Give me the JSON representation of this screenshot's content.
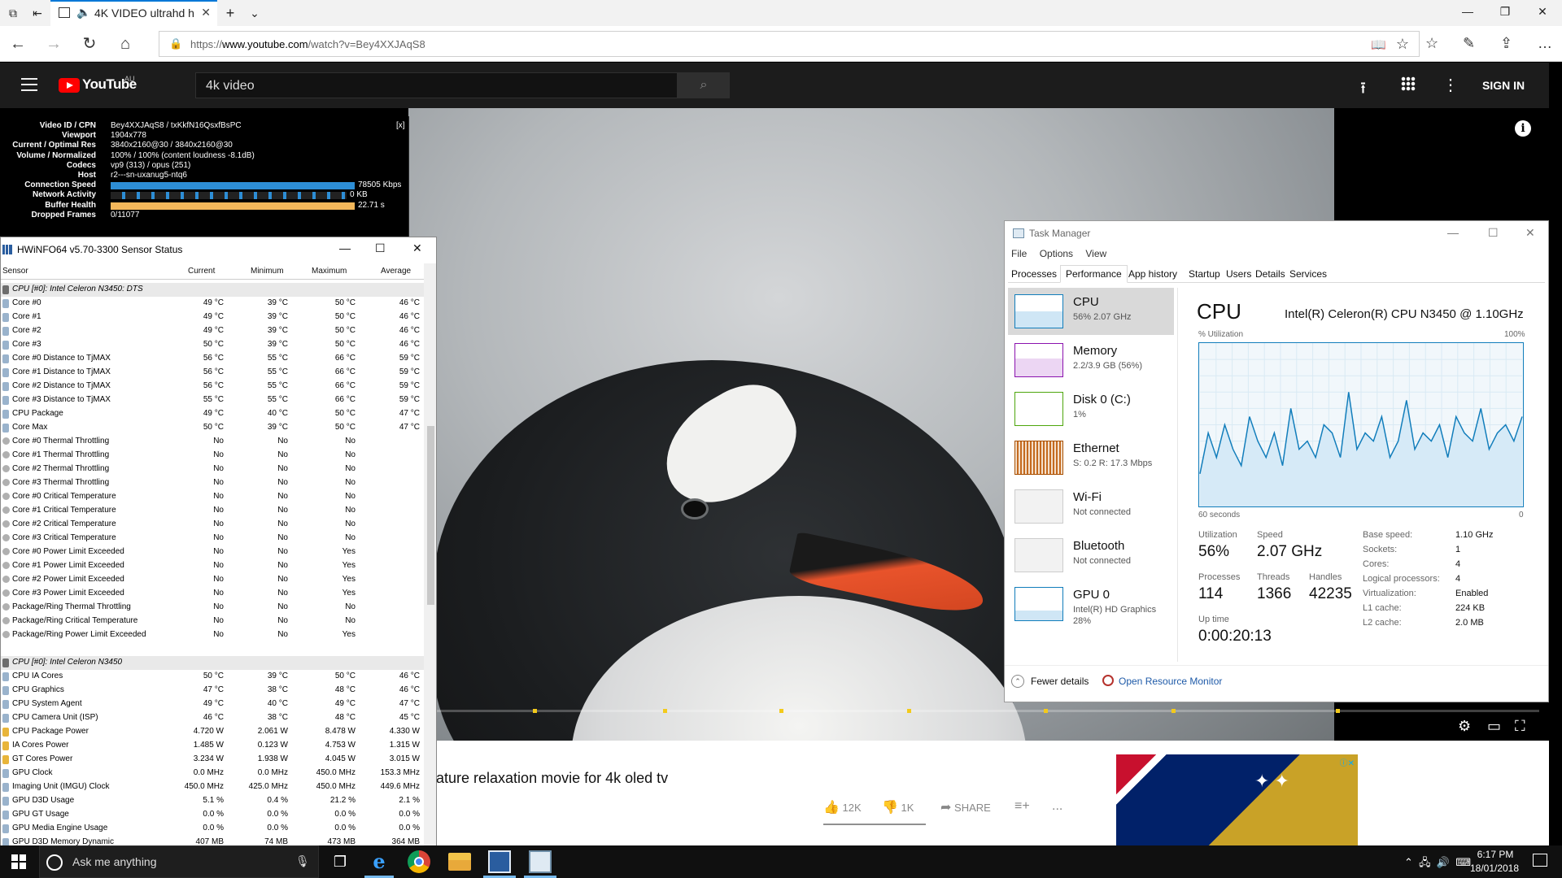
{
  "browser": {
    "tab_title": "4K VIDEO ultrahd h",
    "url_prefix": "https://",
    "url_host": "www.youtube.com",
    "url_path": "/watch?v=Bey4XXJAqS8"
  },
  "youtube": {
    "brand": "YouTube",
    "region": "AU",
    "search_value": "4k video",
    "sign_in": "SIGN IN",
    "video_title": "ature relaxation movie for 4k oled tv",
    "likes": "12K",
    "dislikes": "1K",
    "share": "SHARE",
    "more": "...",
    "info": "i"
  },
  "stats_for_nerds": {
    "close": "[x]",
    "rows": [
      {
        "label": "Video ID / CPN",
        "value": "Bey4XXJAqS8 / txKkfN16QsxfBsPC"
      },
      {
        "label": "Viewport",
        "value": "1904x778"
      },
      {
        "label": "Current / Optimal Res",
        "value": "3840x2160@30 / 3840x2160@30"
      },
      {
        "label": "Volume / Normalized",
        "value": "100% / 100% (content loudness -8.1dB)"
      },
      {
        "label": "Codecs",
        "value": "vp9 (313) / opus (251)"
      },
      {
        "label": "Host",
        "value": "r2---sn-uxanug5-ntq6"
      },
      {
        "label": "Connection Speed",
        "value": "78505 Kbps"
      },
      {
        "label": "Network Activity",
        "value": "0 KB"
      },
      {
        "label": "Buffer Health",
        "value": "22.71 s"
      },
      {
        "label": "Dropped Frames",
        "value": "0/11077"
      }
    ]
  },
  "hwinfo": {
    "title": "HWiNFO64 v5.70-3300 Sensor Status",
    "columns": [
      "Sensor",
      "Current",
      "Minimum",
      "Maximum",
      "Average"
    ],
    "rows": [
      {
        "group": true,
        "name": "CPU [#0]: Intel Celeron N3450: DTS"
      },
      {
        "name": "Core #0",
        "cur": "49 °C",
        "min": "39 °C",
        "max": "50 °C",
        "avg": "46 °C",
        "icon": "temp"
      },
      {
        "name": "Core #1",
        "cur": "49 °C",
        "min": "39 °C",
        "max": "50 °C",
        "avg": "46 °C",
        "icon": "temp"
      },
      {
        "name": "Core #2",
        "cur": "49 °C",
        "min": "39 °C",
        "max": "50 °C",
        "avg": "46 °C",
        "icon": "temp"
      },
      {
        "name": "Core #3",
        "cur": "50 °C",
        "min": "39 °C",
        "max": "50 °C",
        "avg": "46 °C",
        "icon": "temp"
      },
      {
        "name": "Core #0 Distance to TjMAX",
        "cur": "56 °C",
        "min": "55 °C",
        "max": "66 °C",
        "avg": "59 °C",
        "icon": "temp"
      },
      {
        "name": "Core #1 Distance to TjMAX",
        "cur": "56 °C",
        "min": "55 °C",
        "max": "66 °C",
        "avg": "59 °C",
        "icon": "temp"
      },
      {
        "name": "Core #2 Distance to TjMAX",
        "cur": "56 °C",
        "min": "55 °C",
        "max": "66 °C",
        "avg": "59 °C",
        "icon": "temp"
      },
      {
        "name": "Core #3 Distance to TjMAX",
        "cur": "55 °C",
        "min": "55 °C",
        "max": "66 °C",
        "avg": "59 °C",
        "icon": "temp"
      },
      {
        "name": "CPU Package",
        "cur": "49 °C",
        "min": "40 °C",
        "max": "50 °C",
        "avg": "47 °C",
        "icon": "temp"
      },
      {
        "name": "Core Max",
        "cur": "50 °C",
        "min": "39 °C",
        "max": "50 °C",
        "avg": "47 °C",
        "icon": "temp"
      },
      {
        "name": "Core #0 Thermal Throttling",
        "cur": "No",
        "min": "No",
        "max": "No",
        "avg": "",
        "icon": "bool"
      },
      {
        "name": "Core #1 Thermal Throttling",
        "cur": "No",
        "min": "No",
        "max": "No",
        "avg": "",
        "icon": "bool"
      },
      {
        "name": "Core #2 Thermal Throttling",
        "cur": "No",
        "min": "No",
        "max": "No",
        "avg": "",
        "icon": "bool"
      },
      {
        "name": "Core #3 Thermal Throttling",
        "cur": "No",
        "min": "No",
        "max": "No",
        "avg": "",
        "icon": "bool"
      },
      {
        "name": "Core #0 Critical Temperature",
        "cur": "No",
        "min": "No",
        "max": "No",
        "avg": "",
        "icon": "bool"
      },
      {
        "name": "Core #1 Critical Temperature",
        "cur": "No",
        "min": "No",
        "max": "No",
        "avg": "",
        "icon": "bool"
      },
      {
        "name": "Core #2 Critical Temperature",
        "cur": "No",
        "min": "No",
        "max": "No",
        "avg": "",
        "icon": "bool"
      },
      {
        "name": "Core #3 Critical Temperature",
        "cur": "No",
        "min": "No",
        "max": "No",
        "avg": "",
        "icon": "bool"
      },
      {
        "name": "Core #0 Power Limit Exceeded",
        "cur": "No",
        "min": "No",
        "max": "Yes",
        "avg": "",
        "icon": "bool"
      },
      {
        "name": "Core #1 Power Limit Exceeded",
        "cur": "No",
        "min": "No",
        "max": "Yes",
        "avg": "",
        "icon": "bool"
      },
      {
        "name": "Core #2 Power Limit Exceeded",
        "cur": "No",
        "min": "No",
        "max": "Yes",
        "avg": "",
        "icon": "bool"
      },
      {
        "name": "Core #3 Power Limit Exceeded",
        "cur": "No",
        "min": "No",
        "max": "Yes",
        "avg": "",
        "icon": "bool"
      },
      {
        "name": "Package/Ring Thermal Throttling",
        "cur": "No",
        "min": "No",
        "max": "No",
        "avg": "",
        "icon": "bool"
      },
      {
        "name": "Package/Ring Critical Temperature",
        "cur": "No",
        "min": "No",
        "max": "No",
        "avg": "",
        "icon": "bool"
      },
      {
        "name": "Package/Ring Power Limit Exceeded",
        "cur": "No",
        "min": "No",
        "max": "Yes",
        "avg": "",
        "icon": "bool"
      },
      {
        "spacer": true
      },
      {
        "group": true,
        "name": "CPU [#0]: Intel Celeron N3450"
      },
      {
        "name": "CPU IA Cores",
        "cur": "50 °C",
        "min": "39 °C",
        "max": "50 °C",
        "avg": "46 °C",
        "icon": "temp"
      },
      {
        "name": "CPU Graphics",
        "cur": "47 °C",
        "min": "38 °C",
        "max": "48 °C",
        "avg": "46 °C",
        "icon": "temp"
      },
      {
        "name": "CPU System Agent",
        "cur": "49 °C",
        "min": "40 °C",
        "max": "49 °C",
        "avg": "47 °C",
        "icon": "temp"
      },
      {
        "name": "CPU Camera Unit (ISP)",
        "cur": "46 °C",
        "min": "38 °C",
        "max": "48 °C",
        "avg": "45 °C",
        "icon": "temp"
      },
      {
        "name": "CPU Package Power",
        "cur": "4.720 W",
        "min": "2.061 W",
        "max": "8.478 W",
        "avg": "4.330 W",
        "icon": "power"
      },
      {
        "name": "IA Cores Power",
        "cur": "1.485 W",
        "min": "0.123 W",
        "max": "4.753 W",
        "avg": "1.315 W",
        "icon": "power"
      },
      {
        "name": "GT Cores Power",
        "cur": "3.234 W",
        "min": "1.938 W",
        "max": "4.045 W",
        "avg": "3.015 W",
        "icon": "power"
      },
      {
        "name": "GPU Clock",
        "cur": "0.0 MHz",
        "min": "0.0 MHz",
        "max": "450.0 MHz",
        "avg": "153.3 MHz",
        "icon": "clock"
      },
      {
        "name": "Imaging Unit (IMGU) Clock",
        "cur": "450.0 MHz",
        "min": "425.0 MHz",
        "max": "450.0 MHz",
        "avg": "449.6 MHz",
        "icon": "clock"
      },
      {
        "name": "GPU D3D Usage",
        "cur": "5.1 %",
        "min": "0.4 %",
        "max": "21.2 %",
        "avg": "2.1 %",
        "icon": "clock"
      },
      {
        "name": "GPU GT Usage",
        "cur": "0.0 %",
        "min": "0.0 %",
        "max": "0.0 %",
        "avg": "0.0 %",
        "icon": "clock"
      },
      {
        "name": "GPU Media Engine Usage",
        "cur": "0.0 %",
        "min": "0.0 %",
        "max": "0.0 %",
        "avg": "0.0 %",
        "icon": "clock"
      },
      {
        "name": "GPU D3D Memory Dynamic",
        "cur": "407 MB",
        "min": "74 MB",
        "max": "473 MB",
        "avg": "364 MB",
        "icon": "clock"
      }
    ]
  },
  "taskmanager": {
    "title": "Task Manager",
    "menu": [
      "File",
      "Options",
      "View"
    ],
    "tabs": [
      "Processes",
      "Performance",
      "App history",
      "Startup",
      "Users",
      "Details",
      "Services"
    ],
    "active_tab": "Performance",
    "sidebar": [
      {
        "name": "CPU",
        "sub1": "56% 2.07 GHz",
        "sub2": "",
        "color": "#117dbb"
      },
      {
        "name": "Memory",
        "sub1": "2.2/3.9 GB (56%)",
        "sub2": "",
        "color": "#8b12ae"
      },
      {
        "name": "Disk 0 (C:)",
        "sub1": "1%",
        "sub2": "",
        "color": "#4da60c"
      },
      {
        "name": "Ethernet",
        "sub1": "S: 0.2  R: 17.3 Mbps",
        "sub2": "",
        "color": "#a74f01"
      },
      {
        "name": "Wi-Fi",
        "sub1": "Not connected",
        "sub2": "",
        "color": "#cccccc"
      },
      {
        "name": "Bluetooth",
        "sub1": "Not connected",
        "sub2": "",
        "color": "#cccccc"
      },
      {
        "name": "GPU 0",
        "sub1": "Intel(R) HD Graphics",
        "sub2": "28%",
        "color": "#117dbb"
      }
    ],
    "heading": "CPU",
    "model": "Intel(R) Celeron(R) CPU N3450 @ 1.10GHz",
    "util_label": "% Utilization",
    "util_max": "100%",
    "graph_left": "60 seconds",
    "graph_right": "0",
    "stats": {
      "utilization_label": "Utilization",
      "utilization": "56%",
      "speed_label": "Speed",
      "speed": "2.07 GHz",
      "processes_label": "Processes",
      "processes": "114",
      "threads_label": "Threads",
      "threads": "1366",
      "handles_label": "Handles",
      "handles": "42235",
      "uptime_label": "Up time",
      "uptime": "0:00:20:13"
    },
    "specs": [
      {
        "k": "Base speed:",
        "v": "1.10 GHz"
      },
      {
        "k": "Sockets:",
        "v": "1"
      },
      {
        "k": "Cores:",
        "v": "4"
      },
      {
        "k": "Logical processors:",
        "v": "4"
      },
      {
        "k": "Virtualization:",
        "v": "Enabled"
      },
      {
        "k": "L1 cache:",
        "v": "224 KB"
      },
      {
        "k": "L2 cache:",
        "v": "2.0 MB"
      }
    ],
    "fewer_details": "Fewer details",
    "resource_monitor": "Open Resource Monitor",
    "cpu_series": [
      20,
      45,
      30,
      50,
      35,
      25,
      55,
      40,
      30,
      45,
      25,
      60,
      35,
      40,
      30,
      50,
      45,
      30,
      70,
      35,
      45,
      40,
      55,
      30,
      40,
      65,
      35,
      45,
      40,
      50,
      30,
      55,
      45,
      40,
      60,
      35,
      45,
      50,
      40,
      55
    ]
  },
  "taskbar": {
    "search_placeholder": "Ask me anything",
    "time": "6:17 PM",
    "date": "18/01/2018"
  }
}
